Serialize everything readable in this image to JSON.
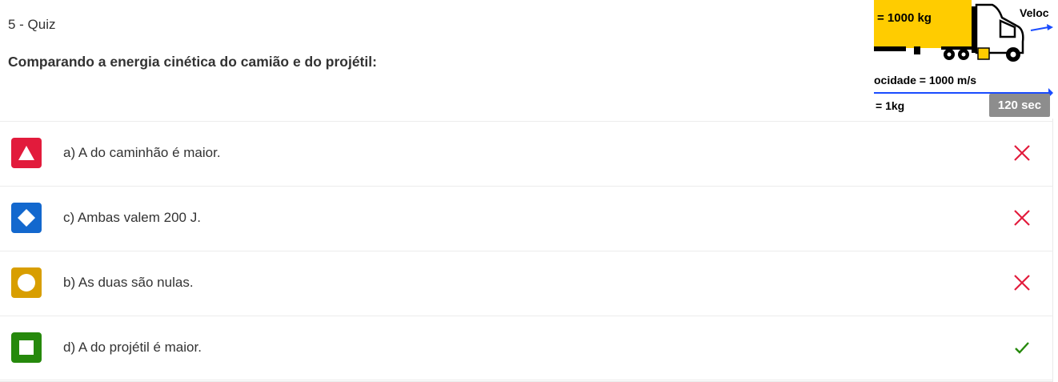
{
  "quiz": {
    "label": "5 - Quiz",
    "question": "Comparando a energia cinética do camião e do projétil:",
    "timer": "120 sec"
  },
  "figure": {
    "mass_truck": "= 1000 kg",
    "velocity_top": "Veloc",
    "velocity_bottom": "ocidade = 1000 m/s",
    "mass_projectile": "= 1kg"
  },
  "answers": [
    {
      "text": "a) A do caminhão é maior.",
      "shape": "triangle-icon",
      "color": "#e21b3c",
      "correct": false
    },
    {
      "text": "c) Ambas valem 200 J.",
      "shape": "diamond-icon",
      "color": "#1368ce",
      "correct": false
    },
    {
      "text": "b) As duas são nulas.",
      "shape": "circle-icon",
      "color": "#d89e00",
      "correct": false
    },
    {
      "text": "d) A do projétil é maior.",
      "shape": "square-icon",
      "color": "#26890c",
      "correct": true
    }
  ],
  "colors": {
    "wrong": "#e21b3c",
    "right": "#26890c",
    "truck_yellow": "#ffcc00",
    "arrow_blue": "#1a4cff"
  }
}
